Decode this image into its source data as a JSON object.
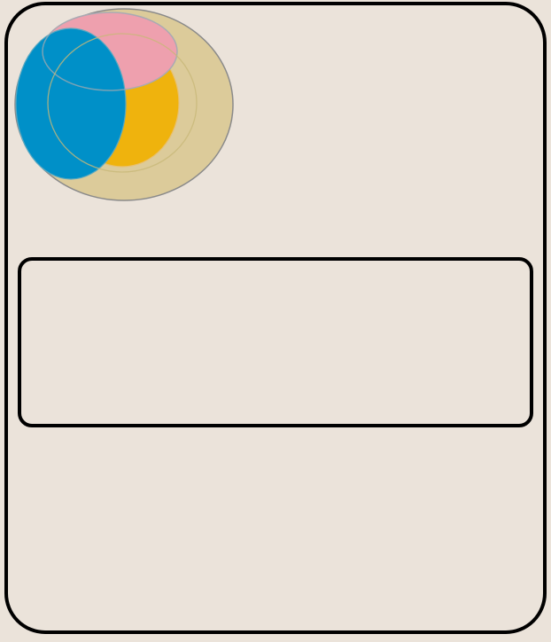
{
  "colors": {
    "background": "#ebe3da",
    "border": "#000000",
    "logo_outer": "#dccb9a",
    "logo_pink": "#eea0ae",
    "logo_yellow": "#efb30d",
    "logo_blue": "#0090c8",
    "logo_outline": "#8a8a8a"
  },
  "logo": {
    "icon": "overlapping-circles-logo-icon"
  },
  "panel": {
    "text": ""
  }
}
